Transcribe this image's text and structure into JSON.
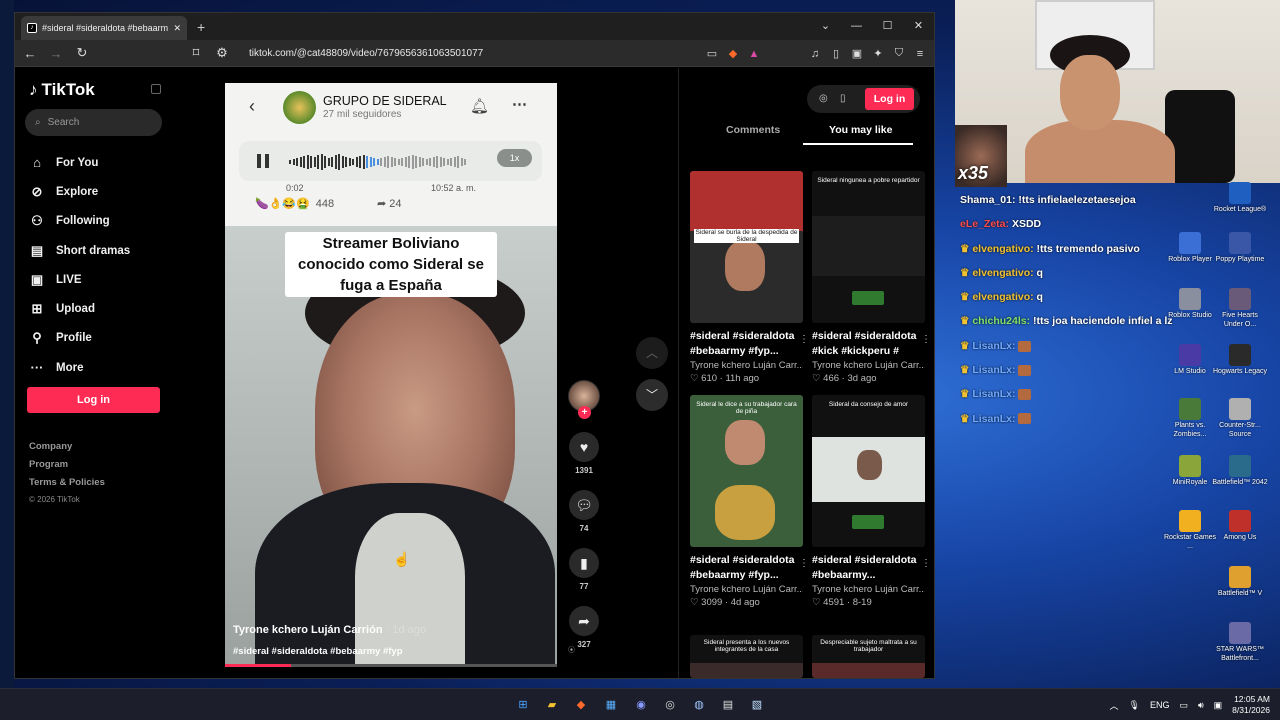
{
  "browser": {
    "tab_title": "#sideral #sideraldota #bebaarmy",
    "url": "tiktok.com/@cat48809/video/7679656361063501077"
  },
  "tiktok": {
    "brand": "TikTok",
    "search_placeholder": "Search",
    "nav": [
      {
        "label": "For You",
        "icon": "home-icon"
      },
      {
        "label": "Explore",
        "icon": "compass-icon"
      },
      {
        "label": "Following",
        "icon": "following-icon"
      },
      {
        "label": "Short dramas",
        "icon": "drama-icon"
      },
      {
        "label": "LIVE",
        "icon": "live-icon"
      },
      {
        "label": "Upload",
        "icon": "upload-icon"
      },
      {
        "label": "Profile",
        "icon": "profile-icon"
      },
      {
        "label": "More",
        "icon": "more-icon"
      }
    ],
    "login_label": "Log in",
    "footer": {
      "company": "Company",
      "program": "Program",
      "terms": "Terms & Policies",
      "copyright": "© 2026 TikTok"
    }
  },
  "video": {
    "group_name": "GRUPO DE SIDERAL",
    "group_followers": "27 mil seguidores",
    "audio_elapsed": "0:02",
    "audio_timestamp": "10:52 a. m.",
    "speed": "1x",
    "reaction_count": "448",
    "share_count_in_video": "24",
    "caption": "Streamer Boliviano conocido como Sideral se fuga a España",
    "author": "Tyrone kchero Luján Carrión",
    "posted": "· 1d ago",
    "tags": "#sideral #sideraldota #bebaarmy #fyp",
    "progress": 0.2,
    "likes": "1391",
    "comments": "74",
    "saves": "77",
    "shares": "327"
  },
  "right_panel": {
    "tabs": {
      "comments": "Comments",
      "like": "You may like"
    },
    "login_label": "Log in",
    "cards": [
      {
        "title": "#sideral #sideraldota",
        "title2": "#bebaarmy #fyp...",
        "author": "Tyrone kchero Luján Carr...",
        "stats": "♡ 610 · 11h ago",
        "thumb_caption": "Sideral se burla de la despedida de Sideral",
        "thumb_color": "#b03030"
      },
      {
        "title": "#sideral #sideraldota",
        "title2": "#kick #kickperu #",
        "author": "Tyrone kchero Luján Carr...",
        "stats": "♡ 466 · 3d ago",
        "thumb_caption": "Sideral ninguneа a pobre repartidor",
        "thumb_color": "#111111"
      },
      {
        "title": "#sideral #sideraldota",
        "title2": "#bebaarmy #fyp...",
        "author": "Tyrone kchero Luján Carr...",
        "stats": "♡ 3099 · 4d ago",
        "thumb_caption": "Sideral le dice a su trabajador cara de piña",
        "thumb_color": "#3b5e3b"
      },
      {
        "title": "#sideral #sideraldota",
        "title2": "#bebaarmy...",
        "author": "Tyrone kchero Luján Carr...",
        "stats": "♡ 4591 · 8-19",
        "thumb_caption": "Sideral da consejo de amor",
        "thumb_color": "#dfe3df"
      },
      {
        "title": "",
        "title2": "",
        "author": "",
        "stats": "",
        "thumb_caption": "Sideral presenta a los nuevos integrantes de la casa",
        "thumb_color": "#111111"
      },
      {
        "title": "",
        "title2": "",
        "author": "",
        "stats": "",
        "thumb_caption": "Despreciable sujeto maltrata a su trabajador",
        "thumb_color": "#111111"
      }
    ]
  },
  "stream": {
    "meme_text": "x35",
    "chat": [
      {
        "user": "Shama_01:",
        "text": "!tts infielaelezetaesejoa",
        "color": "#ffffff",
        "crown": false
      },
      {
        "user": "eLe_Zeta:",
        "text": "XSDD",
        "color": "#ff4d4d",
        "crown": false
      },
      {
        "user": "elvengativo:",
        "text": "!tts tremendo pasivo",
        "color": "#f2c230",
        "crown": true
      },
      {
        "user": "elvengativo:",
        "text": "q",
        "color": "#f2c230",
        "crown": true
      },
      {
        "user": "elvengativo:",
        "text": "q",
        "color": "#f2c230",
        "crown": true
      },
      {
        "user": "chichu24ls:",
        "text": "!tts joa haciendole infiel a lz",
        "color": "#7ee36b",
        "crown": true
      },
      {
        "user": "LisanLx:",
        "text": "",
        "color": "#6fa8ff",
        "crown": true
      },
      {
        "user": "LisanLx:",
        "text": "",
        "color": "#6fa8ff",
        "crown": true
      },
      {
        "user": "LisanLx:",
        "text": "",
        "color": "#6fa8ff",
        "crown": true
      },
      {
        "user": "LisanLx:",
        "text": "",
        "color": "#6fa8ff",
        "crown": true
      }
    ]
  },
  "desktop_icons": [
    {
      "label": "Rocket League®",
      "color": "#1e5fbf"
    },
    {
      "label": "Roblox Player",
      "color": "#3b6fd6"
    },
    {
      "label": "Poppy Playtime",
      "color": "#3a56a6"
    },
    {
      "label": "Roblox Studio",
      "color": "#8a8fa0"
    },
    {
      "label": "Five Hearts Under O...",
      "color": "#6a5a7a"
    },
    {
      "label": "LM Studio",
      "color": "#4a3aa6"
    },
    {
      "label": "Hogwarts Legacy",
      "color": "#2a2a2a"
    },
    {
      "label": "Plants vs. Zombies...",
      "color": "#4a7a3a"
    },
    {
      "label": "Counter-Str... Source",
      "color": "#b0b0b0"
    },
    {
      "label": "MiniRoyale",
      "color": "#8aa63a"
    },
    {
      "label": "Battlefield™ 2042",
      "color": "#2a6a8a"
    },
    {
      "label": "Rockstar Games ...",
      "color": "#f0b020"
    },
    {
      "label": "Among Us",
      "color": "#c0302a"
    },
    {
      "label": "Battlefield™ V",
      "color": "#e0a030"
    },
    {
      "label": "STAR WARS™ Battlefront...",
      "color": "#6a6aa6"
    }
  ],
  "taskbar": {
    "lang": "ENG",
    "time": "12:05 AM",
    "date": "8/31/2026"
  }
}
